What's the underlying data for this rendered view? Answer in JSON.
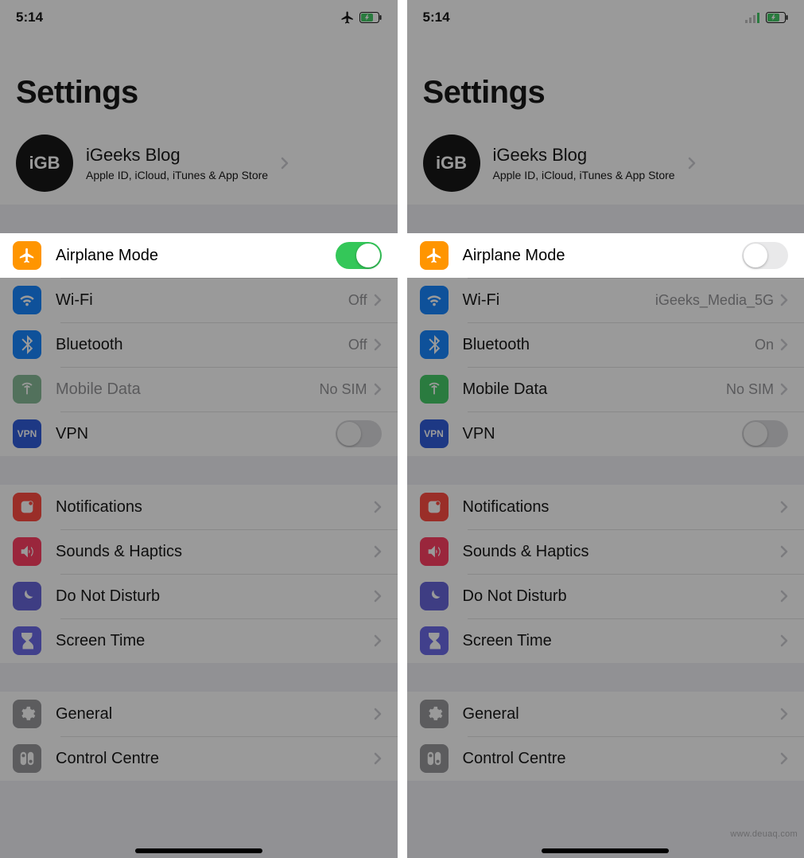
{
  "left": {
    "status": {
      "time": "5:14",
      "airplane": true,
      "battery_charging": true
    },
    "title": "Settings",
    "apple_id": {
      "avatar": "iGB",
      "name": "iGeeks Blog",
      "sub": "Apple ID, iCloud, iTunes & App Store"
    },
    "rows": {
      "airplane": {
        "label": "Airplane Mode",
        "on": true
      },
      "wifi": {
        "label": "Wi-Fi",
        "value": "Off"
      },
      "bluetooth": {
        "label": "Bluetooth",
        "value": "Off"
      },
      "mobile_data": {
        "label": "Mobile Data",
        "value": "No SIM",
        "disabled": true
      },
      "vpn": {
        "label": "VPN",
        "on": false
      },
      "notifications": {
        "label": "Notifications"
      },
      "sounds": {
        "label": "Sounds & Haptics"
      },
      "dnd": {
        "label": "Do Not Disturb"
      },
      "screen_time": {
        "label": "Screen Time"
      },
      "general": {
        "label": "General"
      },
      "control_centre": {
        "label": "Control Centre"
      }
    }
  },
  "right": {
    "status": {
      "time": "5:14",
      "airplane": false,
      "signal": true,
      "battery_charging": true
    },
    "title": "Settings",
    "apple_id": {
      "avatar": "iGB",
      "name": "iGeeks Blog",
      "sub": "Apple ID, iCloud, iTunes & App Store"
    },
    "rows": {
      "airplane": {
        "label": "Airplane Mode",
        "on": false
      },
      "wifi": {
        "label": "Wi-Fi",
        "value": "iGeeks_Media_5G"
      },
      "bluetooth": {
        "label": "Bluetooth",
        "value": "On"
      },
      "mobile_data": {
        "label": "Mobile Data",
        "value": "No SIM"
      },
      "vpn": {
        "label": "VPN",
        "on": false
      },
      "notifications": {
        "label": "Notifications"
      },
      "sounds": {
        "label": "Sounds & Haptics"
      },
      "dnd": {
        "label": "Do Not Disturb"
      },
      "screen_time": {
        "label": "Screen Time"
      },
      "general": {
        "label": "General"
      },
      "control_centre": {
        "label": "Control Centre"
      }
    }
  },
  "watermark": "www.deuaq.com"
}
